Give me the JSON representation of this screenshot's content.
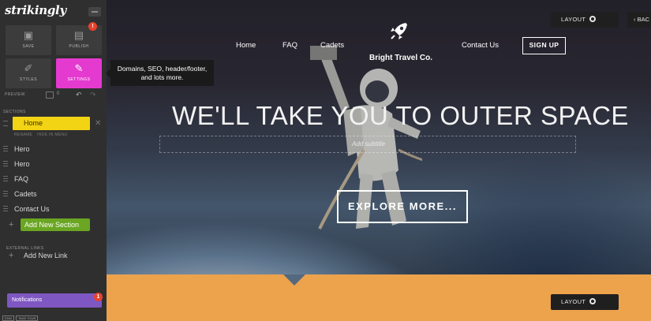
{
  "sidebar": {
    "logo": "strikingly",
    "tiles": {
      "save": "SAVE",
      "publish": "PUBLISH",
      "publish_badge": "!",
      "styles": "STYLES",
      "settings": "SETTINGS"
    },
    "preview": "PREVIEW",
    "preview_count": "0",
    "sections_label": "SECTIONS",
    "sections": [
      "Home",
      "Hero",
      "Hero",
      "FAQ",
      "Cadets",
      "Contact Us"
    ],
    "home_actions": [
      "RENAME",
      "HIDE IN MENU"
    ],
    "add_section": "Add New Section",
    "external_links_label": "EXTERNAL LINKS",
    "add_link": "Add New Link",
    "notifications": "Notifications",
    "notifications_badge": "1",
    "footer_tags": [
      "EDM",
      "TAKE TOUR"
    ]
  },
  "tooltip": {
    "line1": "Domains, SEO, header/footer,",
    "line2": "and lots more."
  },
  "site": {
    "nav": [
      "Home",
      "FAQ",
      "Cadets",
      "Contact Us"
    ],
    "brand": "Bright Travel Co.",
    "signup": "SIGN UP",
    "layout_label": "LAYOUT",
    "back_label": "‹ BAC",
    "headline": "WE'LL TAKE YOU TO OUTER SPACE",
    "subtitle_placeholder": "Add subtitle",
    "cta": "EXPLORE MORE...",
    "next_section_layout": "LAYOUT"
  },
  "colors": {
    "accent_settings": "#e43ad0",
    "home_highlight": "#f3d414",
    "add_section": "#6aa622",
    "notifications": "#7e57c2",
    "next_section_bg": "#eda24c"
  },
  "icons": [
    "save-icon",
    "publish-icon",
    "styles-icon",
    "settings-icon",
    "rocket-icon",
    "gear-icon",
    "undo-icon"
  ]
}
